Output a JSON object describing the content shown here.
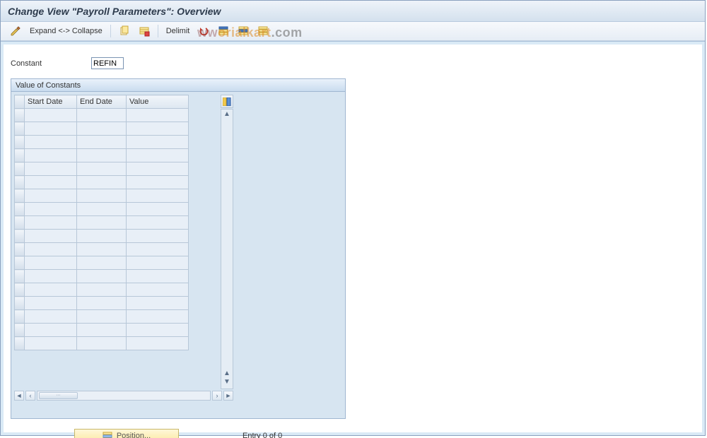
{
  "header": {
    "title": "Change View \"Payroll Parameters\": Overview"
  },
  "toolbar": {
    "expand_label": "Expand <-> Collapse",
    "delimit_label": "Delimit"
  },
  "constant": {
    "label": "Constant",
    "value": "REFIN"
  },
  "panel": {
    "title": "Value of Constants",
    "columns": {
      "start": "Start Date",
      "end": "End Date",
      "value": "Value"
    },
    "row_count": 18
  },
  "footer": {
    "position_label": "Position...",
    "entry_text": "Entry 0 of 0"
  },
  "watermark": {
    "part1": "ww",
    "part2": "orialkart",
    "part3": ".com"
  },
  "icons": {
    "pencil": "pencil-icon",
    "copy": "copy-icon",
    "delete_row": "delete-row-icon",
    "undo": "undo-icon",
    "select_all": "select-all-icon",
    "deselect_all": "deselect-all-icon",
    "configure": "configure-columns-icon",
    "position": "position-icon"
  }
}
